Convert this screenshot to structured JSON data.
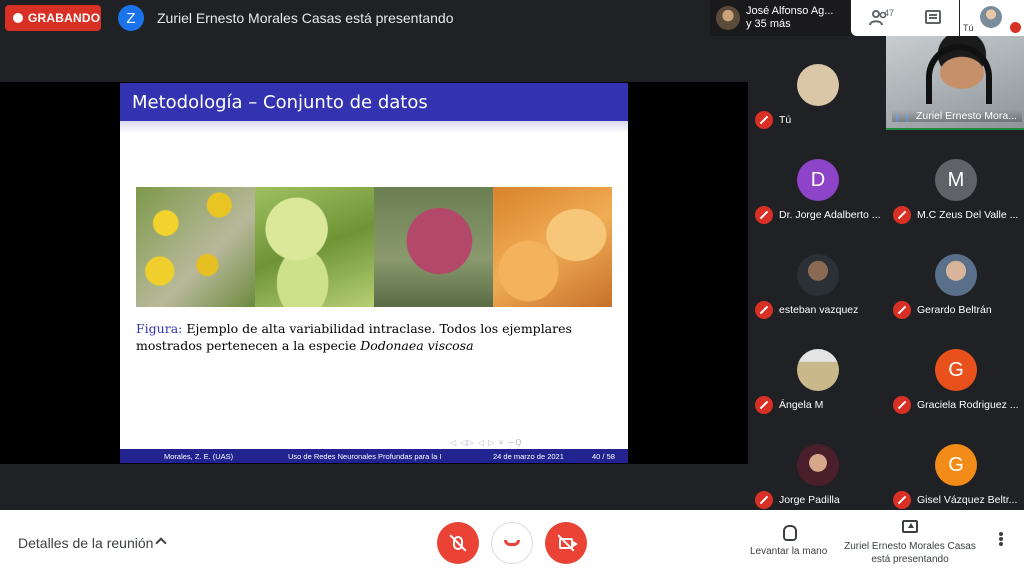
{
  "recording": {
    "label": "GRABANDO",
    "color": "#d93025"
  },
  "presenter_banner": {
    "avatar_letter": "Z",
    "title": "Zuriel Ernesto Morales Casas está presentando"
  },
  "top_people": {
    "line1": "José Alfonso Ag...",
    "line2": "y 35 más"
  },
  "top_controls": {
    "participant_count": "47",
    "people_icon": "people-icon",
    "chat_icon": "chat-icon"
  },
  "self_view": {
    "label": "Tú"
  },
  "slide": {
    "title": "Metodología – Conjunto de datos",
    "caption_label": "Figura:",
    "caption_text": " Ejemplo de alta variabilidad intraclase. Todos los ejemplares mostrados pertenecen a la especie ",
    "caption_species": "Dodonaea viscosa",
    "nav_glyphs": "◁ ◁▷ ◁ ▷ ≡ ∽Q",
    "footer_author": "Morales, Z. E.  (UAS)",
    "footer_title": "Uso de Redes Neuronales Profundas para la I",
    "footer_date": "24 de marzo de 2021",
    "footer_page": "40 / 58",
    "header_color": "#3333b2"
  },
  "presenter_tile": {
    "name": "Zuriel Ernesto Mora..."
  },
  "participants": [
    {
      "name": "Tú",
      "letter": "",
      "color": "#d9c7a8"
    },
    {
      "name": "Dr. Jorge Adalberto ...",
      "letter": "D",
      "color": "#8e44c9"
    },
    {
      "name": "M.C Zeus Del Valle ...",
      "letter": "M",
      "color": "#5f6368"
    },
    {
      "name": "esteban vazquez",
      "letter": "",
      "color": "#7a6552"
    },
    {
      "name": "Gerardo Beltrán",
      "letter": "",
      "color": "#8a8f98"
    },
    {
      "name": "Ángela M",
      "letter": "",
      "color": "#c9b98a"
    },
    {
      "name": "Graciela Rodriguez ...",
      "letter": "G",
      "color": "#e8501c"
    },
    {
      "name": "Jorge Padilla",
      "letter": "",
      "color": "#7c3b4a"
    },
    {
      "name": "Gisel Vázquez Beltr...",
      "letter": "G",
      "color": "#f28b17"
    }
  ],
  "bottom_bar": {
    "details": "Detalles de la reunión",
    "raise_hand": "Levantar la mano",
    "presenting": "Zuriel Ernesto Morales Casas está presentando"
  }
}
